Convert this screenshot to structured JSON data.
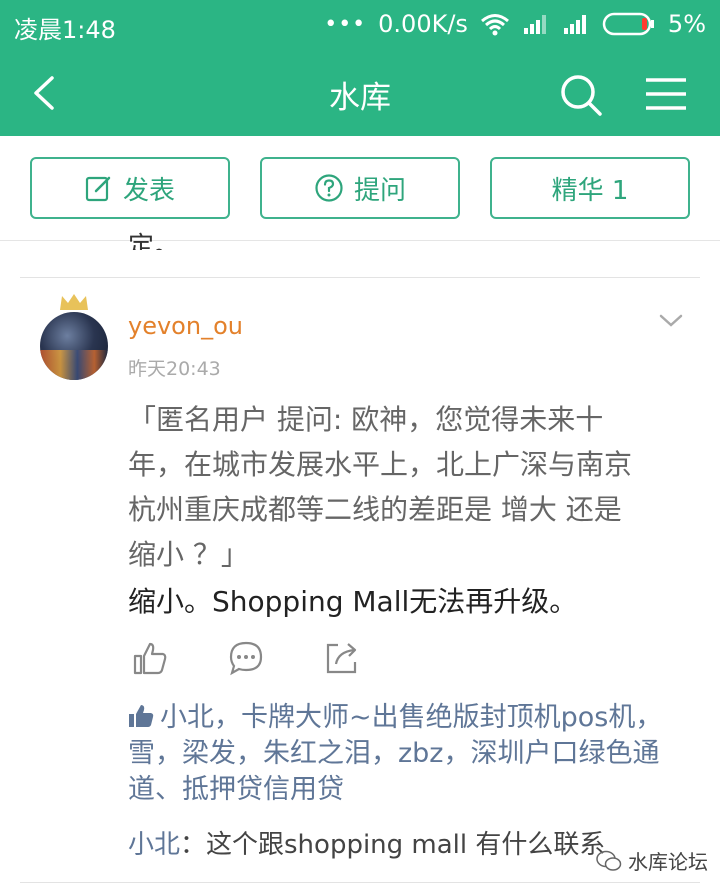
{
  "status_bar": {
    "time": "凌晨1:48",
    "network_speed": "0.00K/s",
    "battery": "5%"
  },
  "app_bar": {
    "title": "水库"
  },
  "toolbar": {
    "post_label": "发表",
    "ask_label": "提问",
    "featured_label": "精华 1"
  },
  "previous_post_fragment": "定。",
  "post": {
    "author": "yevon_ou",
    "time": "昨天20:43",
    "quote_lines": [
      "「匿名用户  提问: 欧神，您觉得未来十",
      "年，在城市发展水平上，北上广深与南京",
      "杭州重庆成都等二线的差距是  增大  还是",
      "缩小 ？」"
    ],
    "reply": "缩小。Shopping  Mall无法再升级。",
    "liked_by_lines": [
      "小北，卡牌大师~出售绝版封顶机pos机，",
      "雪，梁发，朱红之泪，zbz，深圳户口绿色通",
      "道、抵押贷信用贷"
    ],
    "comment": {
      "name": "小北",
      "text": "：这个跟shopping  mall  有什么联系"
    }
  },
  "watermark": "水库论坛",
  "colors": {
    "brand_green": "#2bb584",
    "author_orange": "#e3812b",
    "link_blue": "#5f7697"
  }
}
